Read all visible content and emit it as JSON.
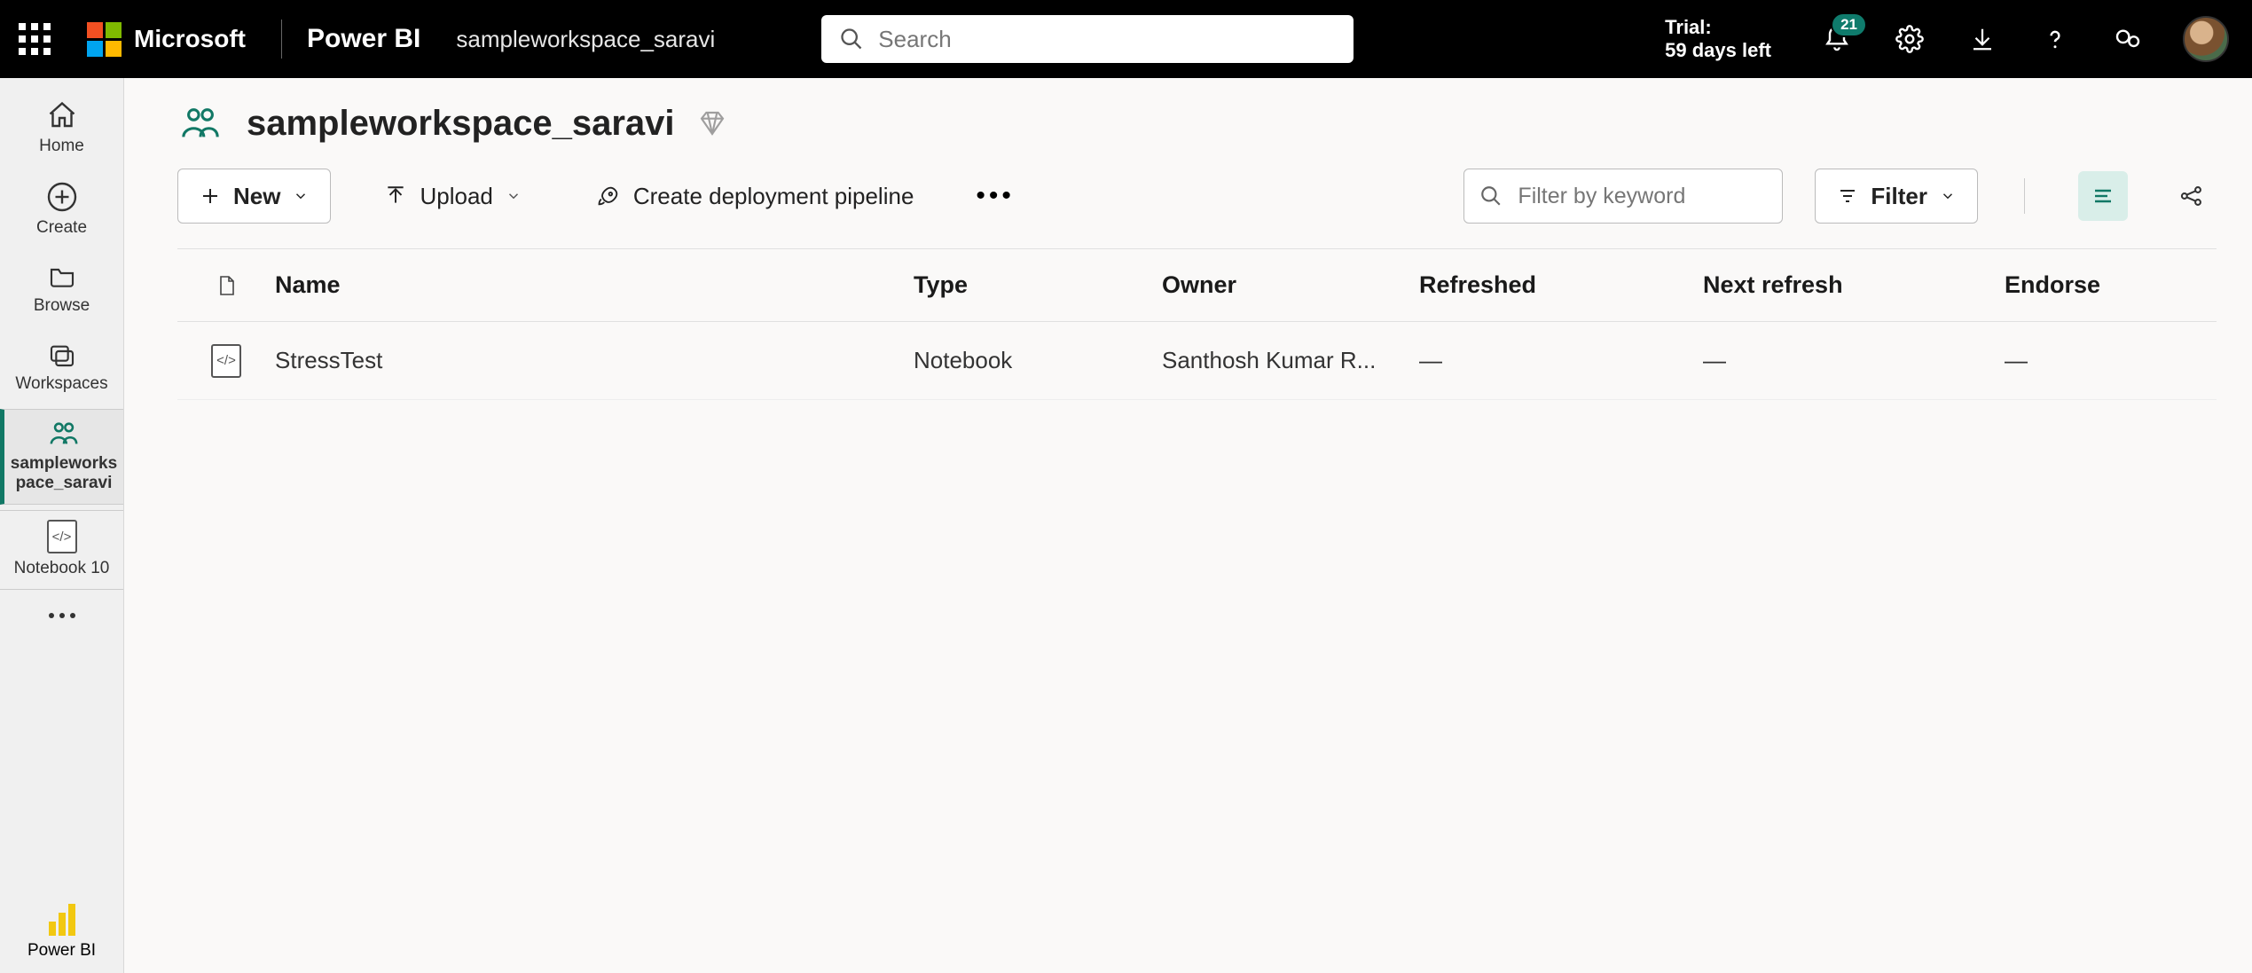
{
  "header": {
    "brand_text": "Microsoft",
    "app_name": "Power BI",
    "breadcrumb": "sampleworkspace_saravi",
    "search_placeholder": "Search",
    "trial_label": "Trial:",
    "trial_remaining": "59 days left",
    "notification_count": "21"
  },
  "leftnav": {
    "home": "Home",
    "create": "Create",
    "browse": "Browse",
    "workspaces": "Workspaces",
    "current_ws": "sampleworkspace_saravi",
    "notebook": "Notebook 10",
    "bottom": "Power BI"
  },
  "workspace": {
    "title": "sampleworkspace_saravi"
  },
  "toolbar": {
    "new": "New",
    "upload": "Upload",
    "pipeline": "Create deployment pipeline",
    "filter_placeholder": "Filter by keyword",
    "filter_btn": "Filter"
  },
  "table": {
    "head": {
      "name": "Name",
      "type": "Type",
      "owner": "Owner",
      "refreshed": "Refreshed",
      "next_refresh": "Next refresh",
      "endorse": "Endorse"
    },
    "rows": [
      {
        "name": "StressTest",
        "type": "Notebook",
        "owner": "Santhosh Kumar R...",
        "refreshed": "—",
        "next_refresh": "—",
        "endorse": "—"
      }
    ]
  }
}
